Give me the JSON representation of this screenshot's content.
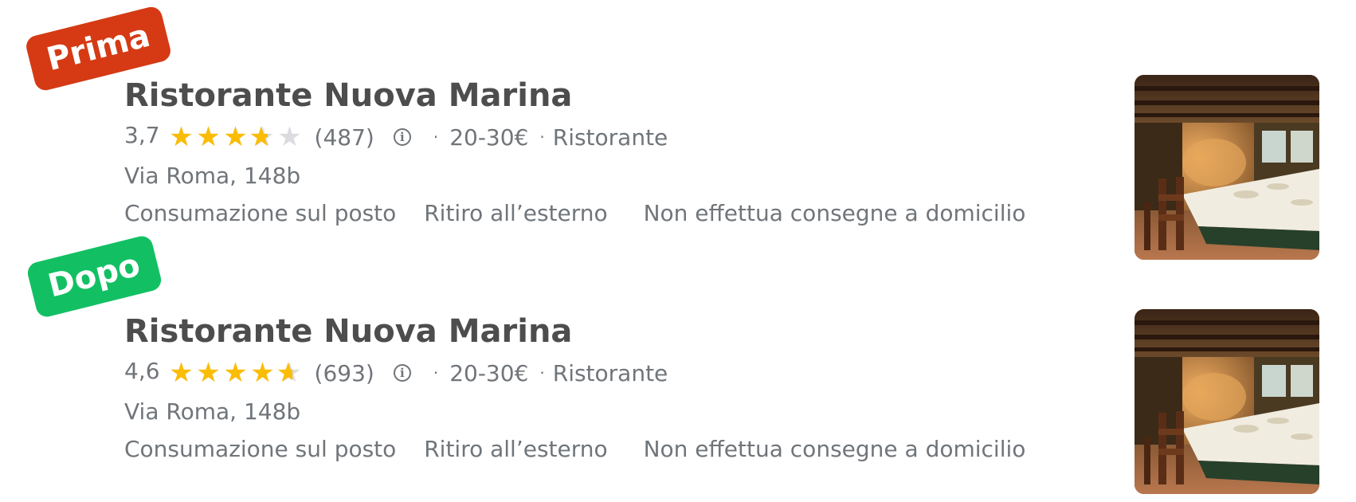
{
  "colors": {
    "before_tag": "#d53a14",
    "after_tag": "#12c063",
    "star": "#fbbc04",
    "star_empty": "#dadce0",
    "title": "#4d4d4d",
    "meta": "#70757a"
  },
  "cards": [
    {
      "tag": "Prima",
      "title": "Ristorante Nuova Marina",
      "rating": "3,7",
      "stars_value": 3.7,
      "reviews": "(487)",
      "info_icon": "info-icon",
      "price": "20-30€",
      "category": "Ristorante",
      "address": "Via Roma, 148b",
      "services": [
        "Consumazione sul posto",
        "Ritiro all’esterno",
        "Non effettua consegne a domicilio"
      ],
      "image": "restaurant-interior-photo"
    },
    {
      "tag": "Dopo",
      "title": "Ristorante Nuova Marina",
      "rating": "4,6",
      "stars_value": 4.6,
      "reviews": "(693)",
      "info_icon": "info-icon",
      "price": "20-30€",
      "category": "Ristorante",
      "address": "Via Roma, 148b",
      "services": [
        "Consumazione sul posto",
        "Ritiro all’esterno",
        "Non effettua consegne a domicilio"
      ],
      "image": "restaurant-interior-photo"
    }
  ]
}
